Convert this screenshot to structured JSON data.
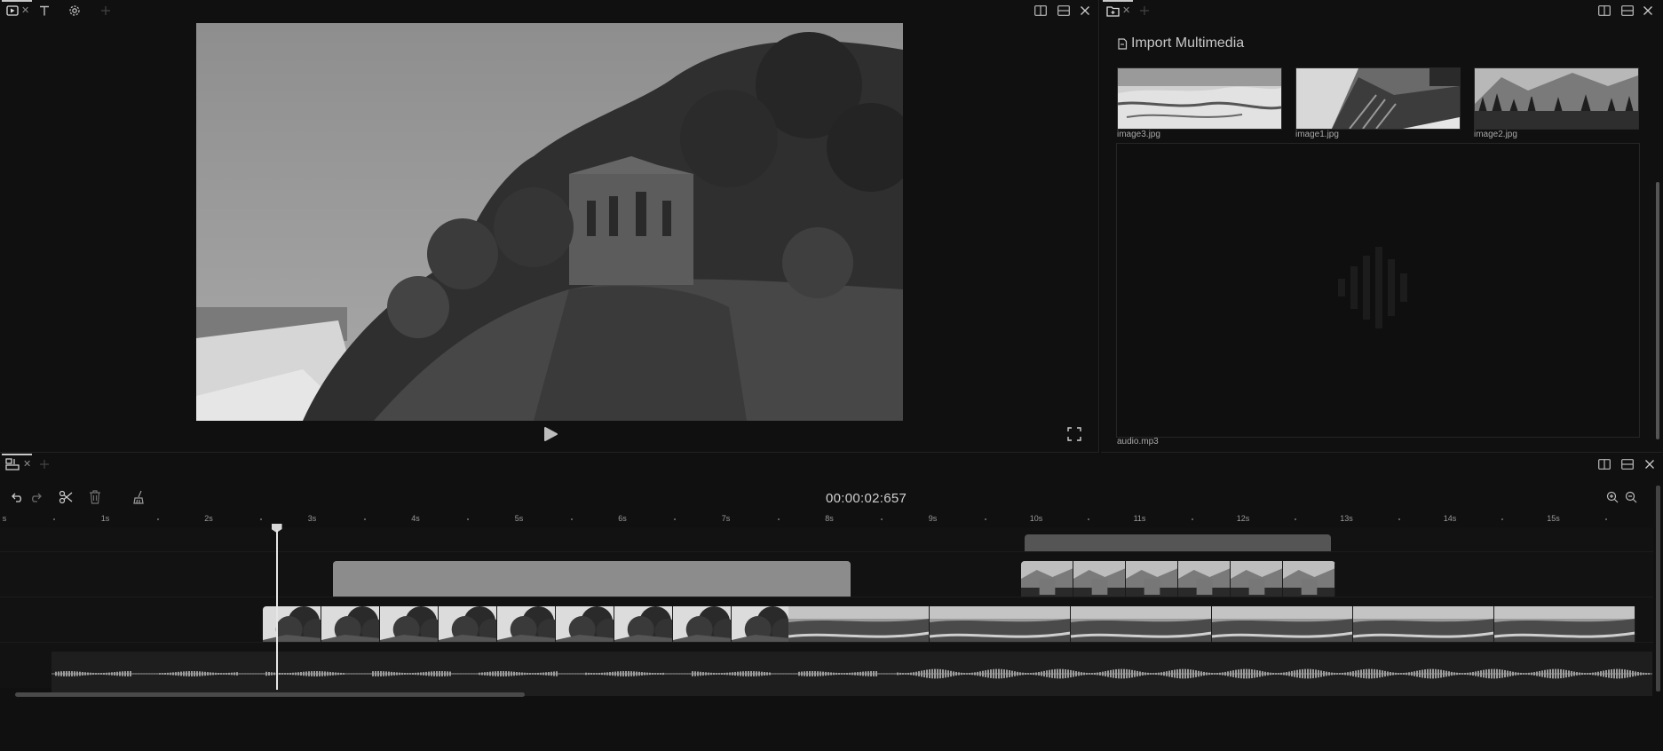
{
  "preview": {
    "tabs": [
      "",
      "",
      ""
    ]
  },
  "media": {
    "import_label": "Import Multimedia",
    "items": [
      {
        "name": "image3.jpg"
      },
      {
        "name": "image1.jpg"
      },
      {
        "name": "image2.jpg"
      }
    ],
    "audio_name": "audio.mp3"
  },
  "timeline": {
    "timecode": "00:00:02:657",
    "ruler_labels": [
      "s",
      "1s",
      "2s",
      "3s",
      "4s",
      "5s",
      "6s",
      "7s",
      "8s",
      "9s",
      "10s",
      "11s",
      "12s",
      "13s",
      "14s",
      "15s"
    ],
    "playhead_seconds": 2.657
  },
  "icons": {
    "preview_tab": "video-preview-icon",
    "text_tab": "text-icon",
    "settings_tab": "gear-icon",
    "add_tab": "plus-icon",
    "split_v": "split-vertical-icon",
    "split_h": "split-horizontal-icon",
    "close": "close-icon",
    "media_tab": "folder-add-icon",
    "timeline_tab": "timeline-icon",
    "undo": "undo-icon",
    "redo": "redo-icon",
    "cut": "scissors-icon",
    "delete": "trash-icon",
    "clean": "broom-icon",
    "zoom_in": "zoom-in-icon",
    "zoom_out": "zoom-out-icon",
    "play": "play-icon",
    "fullscreen": "fullscreen-icon",
    "import": "file-icon",
    "audio": "waveform-icon"
  },
  "colors": {
    "background": "#0e0e0e",
    "panel": "#101010",
    "clip_gray": "#8c8c8c",
    "clip_dark": "#555555",
    "playhead": "#e6e6e6"
  }
}
